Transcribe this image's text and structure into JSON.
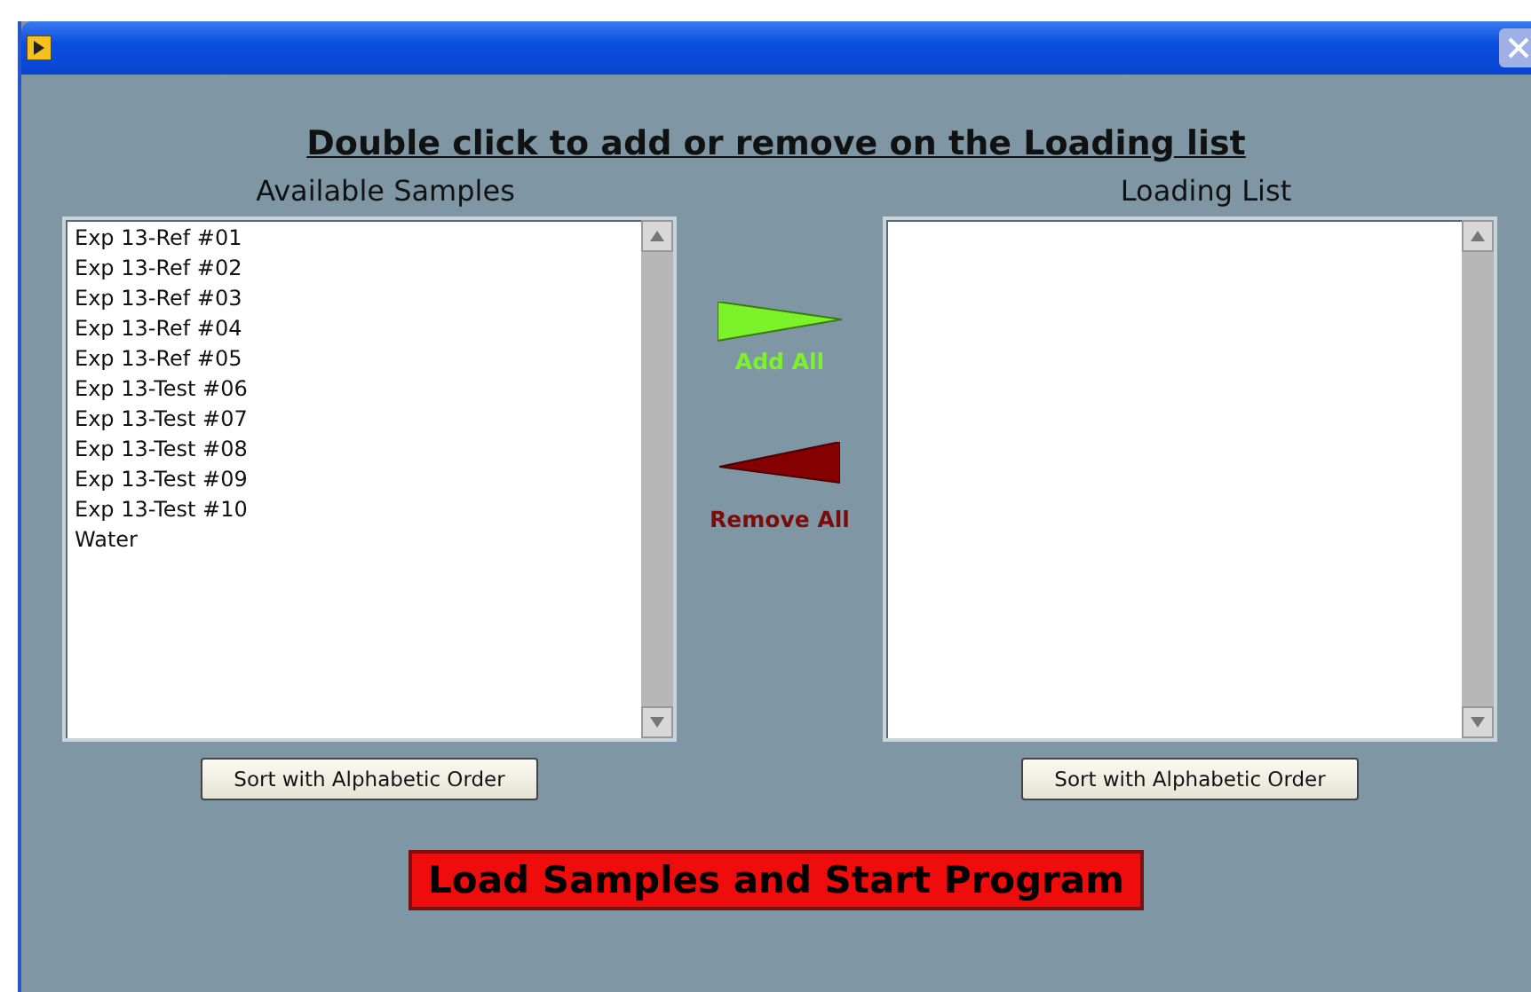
{
  "heading": "Double click to add or remove on the Loading list",
  "lists": [
    {
      "title": "Available Samples",
      "items": [
        "Exp 13-Ref #01",
        "Exp 13-Ref #02",
        "Exp 13-Ref #03",
        "Exp 13-Ref #04",
        "Exp 13-Ref #05",
        "Exp 13-Test #06",
        "Exp 13-Test #07",
        "Exp 13-Test #08",
        "Exp 13-Test #09",
        "Exp 13-Test #10",
        "Water"
      ],
      "sort_button": "Sort with Alphabetic Order"
    },
    {
      "title": "Loading List",
      "sort_button": "Sort with Alphabetic Order"
    }
  ],
  "transfer": [
    {
      "kind": "add",
      "label": "Add All"
    },
    {
      "kind": "remove",
      "label": "Remove All"
    }
  ],
  "start_button": "Load Samples and Start Program"
}
